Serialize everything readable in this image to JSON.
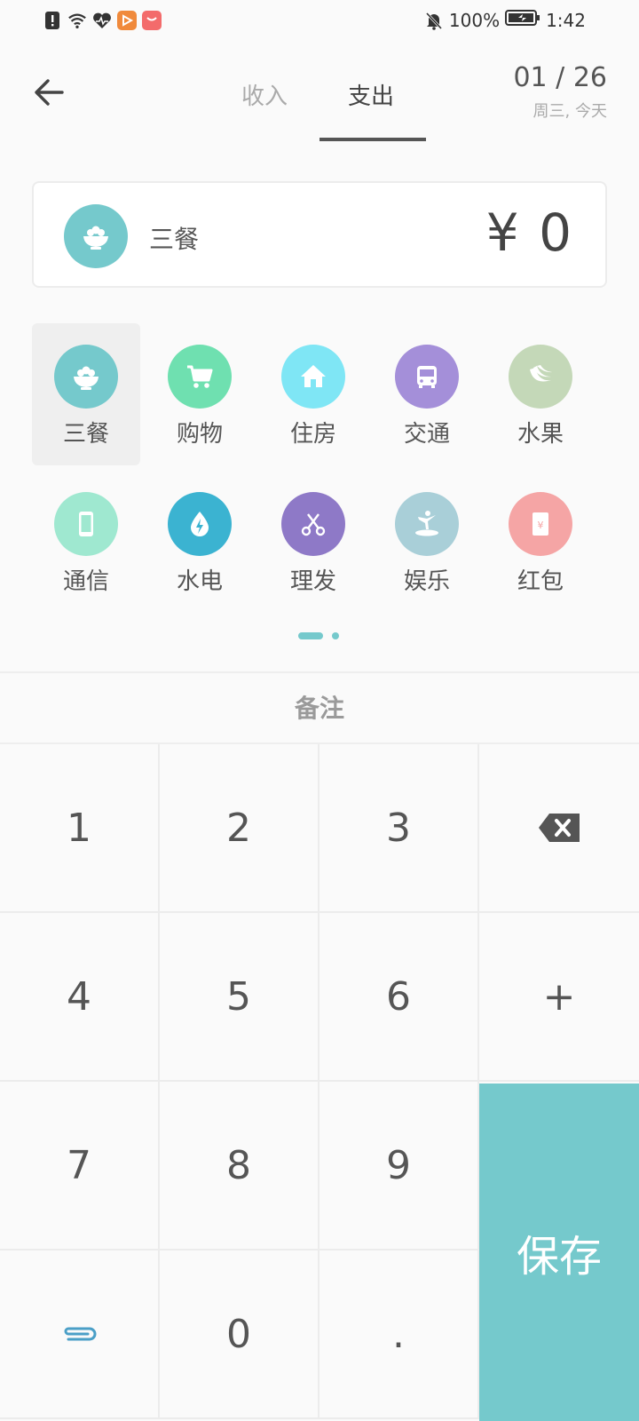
{
  "status_bar": {
    "battery": "100%",
    "time": "1:42"
  },
  "header": {
    "tabs": [
      {
        "label": "收入",
        "active": false
      },
      {
        "label": "支出",
        "active": true
      }
    ],
    "date": "01 / 26",
    "date_sub": "周三, 今天"
  },
  "amount_card": {
    "category": "三餐",
    "amount": "¥ 0",
    "icon_color": "#75c9cc"
  },
  "categories": [
    {
      "label": "三餐",
      "icon": "rice-bowl-icon",
      "color": "#75c9cc",
      "selected": true
    },
    {
      "label": "购物",
      "icon": "cart-icon",
      "color": "#6fe0b0",
      "selected": false
    },
    {
      "label": "住房",
      "icon": "house-icon",
      "color": "#7fe6f5",
      "selected": false
    },
    {
      "label": "交通",
      "icon": "bus-icon",
      "color": "#a48fd9",
      "selected": false
    },
    {
      "label": "水果",
      "icon": "banana-icon",
      "color": "#c4d8b8",
      "selected": false
    },
    {
      "label": "通信",
      "icon": "phone-icon",
      "color": "#9fe8d0",
      "selected": false
    },
    {
      "label": "水电",
      "icon": "water-bolt-icon",
      "color": "#3bb3d1",
      "selected": false
    },
    {
      "label": "理发",
      "icon": "scissors-icon",
      "color": "#8e79c7",
      "selected": false
    },
    {
      "label": "娱乐",
      "icon": "skater-icon",
      "color": "#a9cfd8",
      "selected": false
    },
    {
      "label": "红包",
      "icon": "red-envelope-icon",
      "color": "#f5a5a5",
      "selected": false
    }
  ],
  "note_label": "备注",
  "keypad": {
    "keys": [
      "1",
      "2",
      "3",
      "4",
      "5",
      "6",
      "+",
      "7",
      "8",
      "9",
      "0",
      "."
    ],
    "save_label": "保存"
  }
}
